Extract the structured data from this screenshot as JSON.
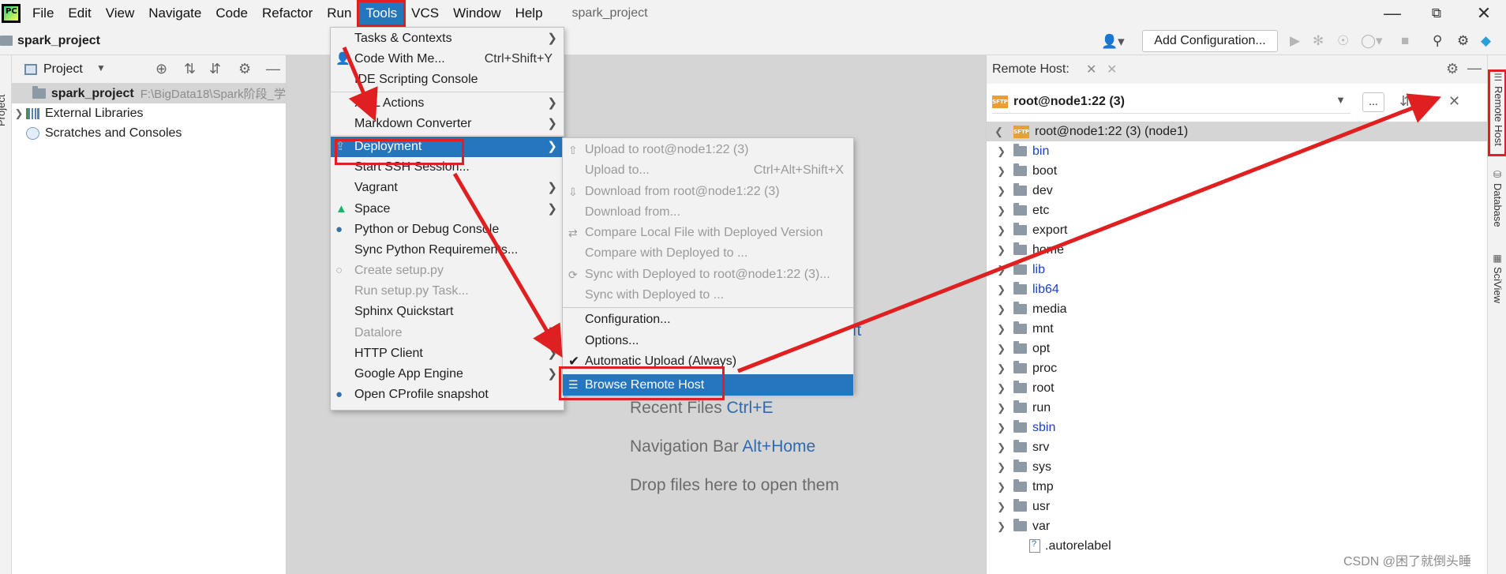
{
  "menubar": {
    "logo_text": "PC",
    "items": [
      "File",
      "Edit",
      "View",
      "Navigate",
      "Code",
      "Refactor",
      "Run",
      "Tools",
      "VCS",
      "Window",
      "Help"
    ],
    "active_item": "Tools",
    "window_title": "spark_project"
  },
  "navbar": {
    "project": "spark_project",
    "add_configuration": "Add Configuration..."
  },
  "left_stripe": {
    "label": "Project"
  },
  "project_panel": {
    "title": "Project",
    "tree": {
      "root_name": "spark_project",
      "root_path": "F:\\BigData18\\Spark阶段_学",
      "external_libraries": "External Libraries",
      "scratches": "Scratches and Consoles"
    }
  },
  "editor": {
    "hints": [
      {
        "text": "Recent Files ",
        "key": "Ctrl+E"
      },
      {
        "text": "Navigation Bar ",
        "key": "Alt+Home"
      },
      {
        "text": "Drop files here to open them",
        "key": ""
      }
    ],
    "partial_text": "ift"
  },
  "tools_menu": {
    "items": [
      {
        "label": "Tasks & Contexts",
        "shortcut": "",
        "submenu": true,
        "disabled": false,
        "icon": ""
      },
      {
        "label": "Code With Me...",
        "shortcut": "Ctrl+Shift+Y",
        "submenu": false,
        "disabled": false,
        "icon": "user-icon"
      },
      {
        "label": "IDE Scripting Console",
        "shortcut": "",
        "submenu": false,
        "disabled": false,
        "icon": ""
      },
      {
        "label": "XML Actions",
        "shortcut": "",
        "submenu": true,
        "disabled": false,
        "icon": ""
      },
      {
        "label": "Markdown Converter",
        "shortcut": "",
        "submenu": true,
        "disabled": false,
        "icon": ""
      },
      {
        "label": "Deployment",
        "shortcut": "",
        "submenu": true,
        "disabled": false,
        "icon": "deployment-icon",
        "active": true
      },
      {
        "label": "Start SSH Session...",
        "shortcut": "",
        "submenu": false,
        "disabled": false,
        "icon": ""
      },
      {
        "label": "Vagrant",
        "shortcut": "",
        "submenu": true,
        "disabled": false,
        "icon": ""
      },
      {
        "label": "Space",
        "shortcut": "",
        "submenu": true,
        "disabled": false,
        "icon": "space-icon"
      },
      {
        "label": "Python or Debug Console",
        "shortcut": "",
        "submenu": false,
        "disabled": false,
        "icon": "python-icon"
      },
      {
        "label": "Sync Python Requirements...",
        "shortcut": "",
        "submenu": false,
        "disabled": false,
        "icon": ""
      },
      {
        "label": "Create setup.py",
        "shortcut": "",
        "submenu": false,
        "disabled": true,
        "icon": "python-disabled-icon"
      },
      {
        "label": "Run setup.py Task...",
        "shortcut": "",
        "submenu": false,
        "disabled": true,
        "icon": ""
      },
      {
        "label": "Sphinx Quickstart",
        "shortcut": "",
        "submenu": false,
        "disabled": false,
        "icon": ""
      },
      {
        "label": "Datalore",
        "shortcut": "",
        "submenu": true,
        "disabled": true,
        "icon": ""
      },
      {
        "label": "HTTP Client",
        "shortcut": "",
        "submenu": true,
        "disabled": false,
        "icon": ""
      },
      {
        "label": "Google App Engine",
        "shortcut": "",
        "submenu": true,
        "disabled": false,
        "icon": ""
      },
      {
        "label": "Open CProfile snapshot",
        "shortcut": "",
        "submenu": false,
        "disabled": false,
        "icon": "python-icon"
      }
    ]
  },
  "deployment_menu": {
    "items": [
      {
        "label": "Upload to root@node1:22 (3)",
        "shortcut": "",
        "disabled": true,
        "icon": "upload-icon"
      },
      {
        "label": "Upload to...",
        "shortcut": "Ctrl+Alt+Shift+X",
        "disabled": true,
        "icon": ""
      },
      {
        "label": "Download from root@node1:22 (3)",
        "shortcut": "",
        "disabled": true,
        "icon": "download-icon"
      },
      {
        "label": "Download from...",
        "shortcut": "",
        "disabled": true,
        "icon": ""
      },
      {
        "label": "Compare Local File with Deployed Version",
        "shortcut": "",
        "disabled": true,
        "icon": "compare-icon"
      },
      {
        "label": "Compare with Deployed to ...",
        "shortcut": "",
        "disabled": true,
        "icon": ""
      },
      {
        "label": "Sync with Deployed to root@node1:22 (3)...",
        "shortcut": "",
        "disabled": true,
        "icon": "sync-icon"
      },
      {
        "label": "Sync with Deployed to ...",
        "shortcut": "",
        "disabled": true,
        "icon": ""
      }
    ],
    "items_after_separator": [
      {
        "label": "Configuration...",
        "checked": false
      },
      {
        "label": "Options...",
        "checked": false
      },
      {
        "label": "Automatic Upload (Always)",
        "checked": true
      }
    ],
    "browse": "Browse Remote Host"
  },
  "remote_panel": {
    "title": "Remote Host:",
    "server": "root@node1:22 (3)",
    "more": "...",
    "root_label": "root@node1:22 (3) (node1)",
    "folders": [
      {
        "name": "bin",
        "link": true
      },
      {
        "name": "boot",
        "link": false
      },
      {
        "name": "dev",
        "link": false
      },
      {
        "name": "etc",
        "link": false
      },
      {
        "name": "export",
        "link": false
      },
      {
        "name": "home",
        "link": false
      },
      {
        "name": "lib",
        "link": true
      },
      {
        "name": "lib64",
        "link": true
      },
      {
        "name": "media",
        "link": false
      },
      {
        "name": "mnt",
        "link": false
      },
      {
        "name": "opt",
        "link": false
      },
      {
        "name": "proc",
        "link": false
      },
      {
        "name": "root",
        "link": false
      },
      {
        "name": "run",
        "link": false
      },
      {
        "name": "sbin",
        "link": true
      },
      {
        "name": "srv",
        "link": false
      },
      {
        "name": "sys",
        "link": false
      },
      {
        "name": "tmp",
        "link": false
      },
      {
        "name": "usr",
        "link": false
      },
      {
        "name": "var",
        "link": false
      }
    ],
    "file": ".autorelabel",
    "sftp_badge": "SFTP"
  },
  "right_stripe": {
    "tabs": [
      "Remote Host",
      "Database",
      "SciView"
    ]
  },
  "watermark": "CSDN @困了就倒头睡",
  "colors": {
    "accent": "#2675bf",
    "annotation": "#e02020",
    "link": "#1a3fcf"
  }
}
